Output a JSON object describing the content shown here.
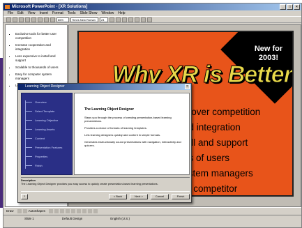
{
  "window": {
    "title": "Microsoft PowerPoint - [XR Solutions]"
  },
  "menubar": [
    "File",
    "Edit",
    "View",
    "Insert",
    "Format",
    "Tools",
    "Slide Show",
    "Window",
    "Help"
  ],
  "toolbar": {
    "zoom": "66%",
    "font": "Times New Roman",
    "font_size": "24"
  },
  "outline": {
    "items": [
      "Exclusive tools for better user competition",
      "Increase cooperation and integration",
      "Less expensive to install and support",
      "Scalable to thousands of users",
      "Easy for computer system managers",
      "Less cost competitor"
    ]
  },
  "slide": {
    "corner_text": "New for 2003!",
    "title": "Why XR is Better",
    "bullets": [
      "e over competition",
      "nd integration",
      "tall and support",
      "ds of users",
      "ystem managers",
      "st competitor"
    ],
    "colors": {
      "background": "#e8541a",
      "title": "#e8d94a",
      "corner": "#000000"
    }
  },
  "dialog": {
    "title": "Learning Object Designer",
    "steps": [
      "Overview",
      "Select Template",
      "Learning Objective",
      "Learning Assets",
      "Content",
      "Presentation Features",
      "Properties",
      "Finish"
    ],
    "heading": "The Learning Object Designer",
    "paragraphs": [
      "Steps you through the process of creating presentation-based learning presentations.",
      "Provides a choice of formats of learning templates.",
      "Lets learning designers quickly add content in simple formats.",
      "Generates instructionally sound presentations with navigation, interactivity and quizzes."
    ],
    "description_label": "Description",
    "description": "The Learning Object Designer provides you easy access to quickly create presentation-based learning presentations.",
    "buttons": {
      "help": "?",
      "back": "< Back",
      "next": "Next >",
      "cancel": "Cancel",
      "finish": "Finish"
    }
  },
  "drawbar": {
    "draw": "Draw",
    "autoshapes": "AutoShapes"
  },
  "status": {
    "slide": "Slide 1",
    "template": "Default Design",
    "language": "English (U.S.)"
  }
}
